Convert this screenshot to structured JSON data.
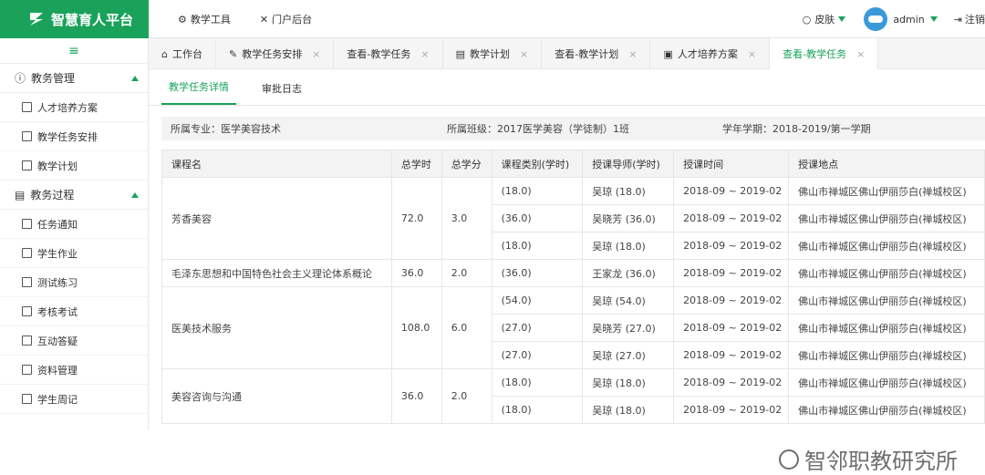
{
  "app": {
    "title": "智慧育人平台"
  },
  "top_nav": [
    {
      "label": "教学工具"
    },
    {
      "label": "门户后台"
    }
  ],
  "top_right": {
    "skin": "皮肤",
    "username": "admin",
    "logout": "注销"
  },
  "sidebar": {
    "groups": [
      {
        "label": "教务管理",
        "items": [
          {
            "label": "人才培养方案",
            "icon": "document-icon"
          },
          {
            "label": "教学任务安排",
            "icon": "edit-icon"
          },
          {
            "label": "教学计划",
            "icon": "list-icon"
          }
        ]
      },
      {
        "label": "教务过程",
        "items": [
          {
            "label": "任务通知",
            "icon": "speaker-icon"
          },
          {
            "label": "学生作业",
            "icon": "book-icon"
          },
          {
            "label": "测试练习",
            "icon": "edit-icon"
          },
          {
            "label": "考核考试",
            "icon": "test-icon"
          },
          {
            "label": "互动答疑",
            "icon": "chat-icon"
          },
          {
            "label": "资料管理",
            "icon": "chart-icon"
          },
          {
            "label": "学生周记",
            "icon": "notebook-icon"
          }
        ]
      }
    ]
  },
  "tabs": [
    {
      "label": "工作台",
      "closable": false,
      "active": false
    },
    {
      "label": "教学任务安排",
      "closable": true,
      "active": false
    },
    {
      "label": "查看-教学任务",
      "closable": true,
      "active": false
    },
    {
      "label": "教学计划",
      "closable": true,
      "active": false
    },
    {
      "label": "查看-教学计划",
      "closable": true,
      "active": false
    },
    {
      "label": "人才培养方案",
      "closable": true,
      "active": false
    },
    {
      "label": "查看-教学任务",
      "closable": true,
      "active": true
    }
  ],
  "subtabs": [
    {
      "label": "教学任务详情",
      "active": true
    },
    {
      "label": "审批日志",
      "active": false
    }
  ],
  "info": {
    "major": "所属专业：医学美容技术",
    "class": "所属班级：2017医学美容（学徒制）1班",
    "term": "学年学期：2018-2019/第一学期"
  },
  "table": {
    "headers": [
      "课程名",
      "总学时",
      "总学分",
      "课程类别(学时)",
      "授课导师(学时)",
      "授课时间",
      "授课地点"
    ],
    "courses": [
      {
        "name": "芳香美容",
        "hours": "72.0",
        "credits": "3.0",
        "rows": [
          {
            "cat": "(18.0)",
            "teacher": "吴琼 (18.0)",
            "time": "2018-09 ~ 2019-02",
            "place": "佛山市禅城区佛山伊丽莎白(禅城校区)"
          },
          {
            "cat": "(36.0)",
            "teacher": "吴晓芳 (36.0)",
            "time": "2018-09 ~ 2019-02",
            "place": "佛山市禅城区佛山伊丽莎白(禅城校区)"
          },
          {
            "cat": "(18.0)",
            "teacher": "吴琼 (18.0)",
            "time": "2018-09 ~ 2019-02",
            "place": "佛山市禅城区佛山伊丽莎白(禅城校区)"
          }
        ]
      },
      {
        "name": "毛泽东思想和中国特色社会主义理论体系概论",
        "hours": "36.0",
        "credits": "2.0",
        "rows": [
          {
            "cat": "(36.0)",
            "teacher": "王家龙 (36.0)",
            "time": "2018-09 ~ 2019-02",
            "place": "佛山市禅城区佛山伊丽莎白(禅城校区)"
          }
        ]
      },
      {
        "name": "医美技术服务",
        "hours": "108.0",
        "credits": "6.0",
        "rows": [
          {
            "cat": "(54.0)",
            "teacher": "吴琼 (54.0)",
            "time": "2018-09 ~ 2019-02",
            "place": "佛山市禅城区佛山伊丽莎白(禅城校区)"
          },
          {
            "cat": "(27.0)",
            "teacher": "吴晓芳 (27.0)",
            "time": "2018-09 ~ 2019-02",
            "place": "佛山市禅城区佛山伊丽莎白(禅城校区)"
          },
          {
            "cat": "(27.0)",
            "teacher": "吴琼 (27.0)",
            "time": "2018-09 ~ 2019-02",
            "place": "佛山市禅城区佛山伊丽莎白(禅城校区)"
          }
        ]
      },
      {
        "name": "美容咨询与沟通",
        "hours": "36.0",
        "credits": "2.0",
        "rows": [
          {
            "cat": "(18.0)",
            "teacher": "吴琼 (18.0)",
            "time": "2018-09 ~ 2019-02",
            "place": "佛山市禅城区佛山伊丽莎白(禅城校区)"
          },
          {
            "cat": "(18.0)",
            "teacher": "吴琼 (18.0)",
            "time": "2018-09 ~ 2019-02",
            "place": "佛山市禅城区佛山伊丽莎白(禅城校区)"
          }
        ]
      }
    ]
  },
  "watermark": "智邻职教研究所",
  "colors": {
    "brand": "#1aa25a",
    "header_bg": "#f3f3f3",
    "border": "#e6e6e6"
  }
}
